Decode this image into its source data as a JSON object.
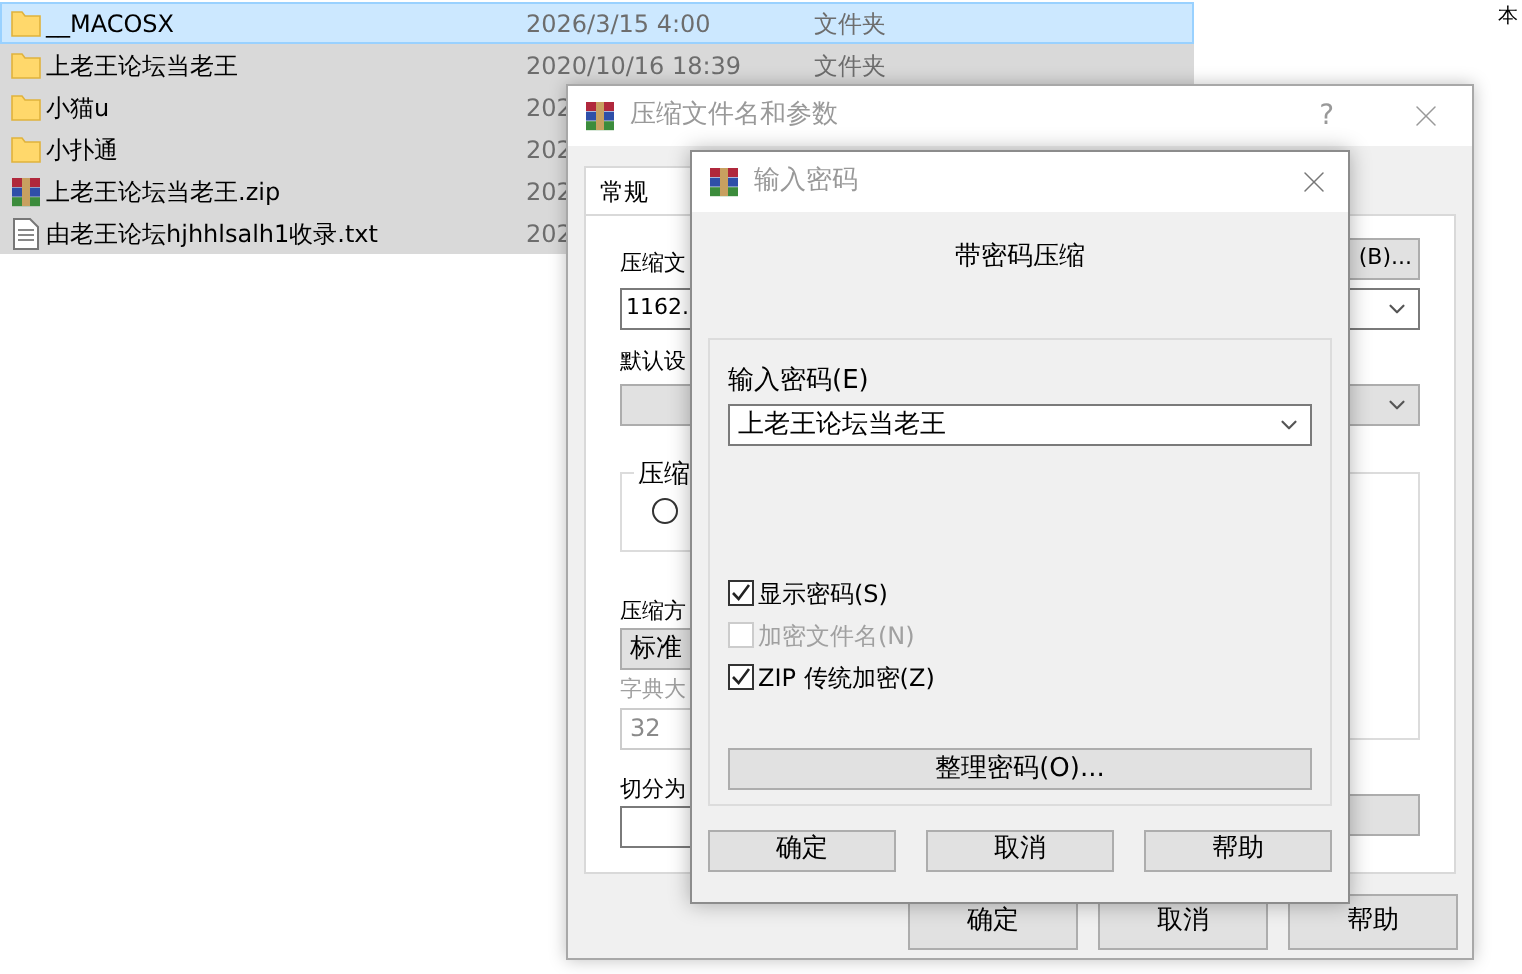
{
  "explorer": {
    "files": [
      {
        "kind": "folder",
        "name": "__MACOSX",
        "date": "2026/3/15 4:00",
        "type": "文件夹",
        "selected": true,
        "focused": true
      },
      {
        "kind": "folder",
        "name": "上老王论坛当老王",
        "date": "2020/10/16 18:39",
        "type": "文件夹",
        "selected": true,
        "focused": false
      },
      {
        "kind": "folder",
        "name": "小猫u",
        "date": "202",
        "selected": true,
        "focused": false
      },
      {
        "kind": "folder",
        "name": "小扑通",
        "date": "202",
        "selected": true,
        "focused": false
      },
      {
        "kind": "archive",
        "name": "上老王论坛当老王.zip",
        "date": "202",
        "selected": true,
        "focused": false
      },
      {
        "kind": "text",
        "name": "由老王论坛hjhhlsalh1收录.txt",
        "date": "202",
        "selected": true,
        "focused": false
      }
    ],
    "side_text": "本"
  },
  "archive_dialog": {
    "title": "压缩文件名和参数",
    "help": "?",
    "tabs": [
      {
        "label": "常规",
        "selected": true
      }
    ],
    "archive_name_label": "压缩文",
    "archive_name_value": "1162.",
    "browse_button": "(B)...",
    "profile_label": "默认设",
    "format_group_label": "压缩",
    "format_radio": {
      "selected": false
    },
    "method_label": "压缩方",
    "method_value": "标准",
    "dictionary_label": "字典大",
    "dictionary_value": "32",
    "split_label": "切分为",
    "buttons": [
      "确定",
      "取消",
      "帮助"
    ]
  },
  "password_dialog": {
    "title": "输入密码",
    "heading": "带密码压缩",
    "password_label": "输入密码(E)",
    "password_value": "上老王论坛当老王",
    "options": [
      {
        "label": "显示密码(S)",
        "checked": true,
        "disabled": false
      },
      {
        "label": "加密文件名(N)",
        "checked": false,
        "disabled": true
      },
      {
        "label": "ZIP 传统加密(Z)",
        "checked": true,
        "disabled": false
      }
    ],
    "manage_button": "整理密码(O)...",
    "buttons": [
      "确定",
      "取消",
      "帮助"
    ]
  }
}
